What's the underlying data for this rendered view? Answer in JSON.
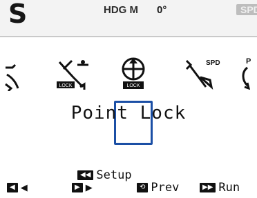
{
  "header": {
    "mode": "S",
    "heading_label": "HDG M",
    "heading_value": "0°",
    "spd_badge": "SPD"
  },
  "icons": [
    {
      "name": "partial-left-icon",
      "badge": ""
    },
    {
      "name": "course-lock-icon",
      "badge": "LOCK"
    },
    {
      "name": "point-lock-icon",
      "badge": "LOCK",
      "selected": true
    },
    {
      "name": "speed-icon",
      "badge": "SPD"
    },
    {
      "name": "partial-right-icon",
      "badge": "P"
    }
  ],
  "title": "Point Lock",
  "bottom": {
    "setup_label": "Setup",
    "prev_label": "Prev",
    "run_label": "Run"
  }
}
